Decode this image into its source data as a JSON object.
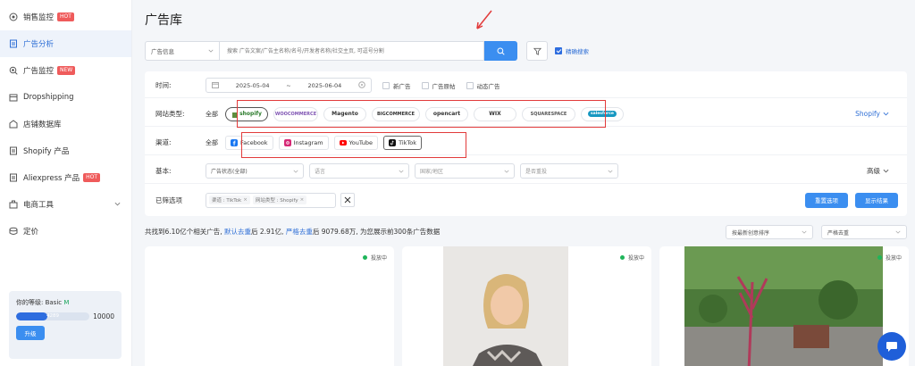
{
  "sidebar": {
    "items": [
      {
        "label": "销售监控",
        "badge": "HOT",
        "icon": "target-icon"
      },
      {
        "label": "广告分析",
        "badge": "",
        "icon": "document-icon",
        "active": true
      },
      {
        "label": "广告监控",
        "badge": "NEW",
        "icon": "search-plus-icon"
      },
      {
        "label": "Dropshipping",
        "badge": "",
        "icon": "box-icon"
      },
      {
        "label": "店铺数据库",
        "badge": "",
        "icon": "shop-icon"
      },
      {
        "label": "Shopify 产品",
        "badge": "",
        "icon": "document-icon"
      },
      {
        "label": "Aliexpress 产品",
        "badge": "HOT",
        "icon": "document-icon"
      },
      {
        "label": "电商工具",
        "badge": "",
        "icon": "toolbox-icon"
      },
      {
        "label": "定价",
        "badge": "",
        "icon": "stack-icon"
      }
    ],
    "level": {
      "label": "你的等级: Basic ",
      "tier": "M",
      "current": "4289",
      "max": "10000",
      "progress": 0.4289,
      "upgrade_label": "升级"
    }
  },
  "page": {
    "title": "广告库"
  },
  "search": {
    "select_label": "广告信息",
    "placeholder": "搜索 广告文案/广告主名称/名号/开发者名称/社交主页, 可逗号分割",
    "exact_label": "精确搜索"
  },
  "filters": {
    "time": {
      "label": "时间:",
      "start": "2025-05-04",
      "sep": "~",
      "end": "2025-06-04",
      "options": [
        "新广告",
        "广告原帖",
        "动态广告"
      ]
    },
    "site": {
      "label": "网站类型:",
      "all": "全部",
      "logos": [
        "shopify",
        "WOOCOMMERCE",
        "Magento",
        "BIGCOMMERCE",
        "opencart",
        "WIX",
        "SQUARESPACE",
        "salesforce"
      ],
      "right_link": "Shopify"
    },
    "channel": {
      "label": "渠道:",
      "all": "全部",
      "items": [
        "Facebook",
        "Instagram",
        "YouTube",
        "TikTok"
      ]
    },
    "basic": {
      "label": "基本:",
      "selects": [
        "广告状态(全部)",
        "语言",
        "国家/地区",
        "是否重投"
      ],
      "right": "高级"
    },
    "chosen": {
      "label": "已筛选项",
      "tags": [
        "渠道 : TikTok",
        "网站类型 : Shopify"
      ],
      "reset_label": "重置选项",
      "show_label": "显示结果"
    }
  },
  "results": {
    "prefix": "共找到6.10亿个相关广告, ",
    "link1": "默认去重",
    "mid1": "后 2.91亿, ",
    "link2": "严格去重",
    "suffix": "后 9079.68万, 为您展示前300条广告数据",
    "sort_label": "按最新创意排序",
    "dedup_label": "严格去重"
  },
  "cards": [
    {
      "status": "投放中"
    },
    {
      "status": "投放中"
    },
    {
      "status": "投放中"
    }
  ],
  "colors": {
    "accent": "#3b8ef0",
    "active_dot": "#1fb55a",
    "hot": "#ef5b5b",
    "highlight": "#e23b3b"
  }
}
